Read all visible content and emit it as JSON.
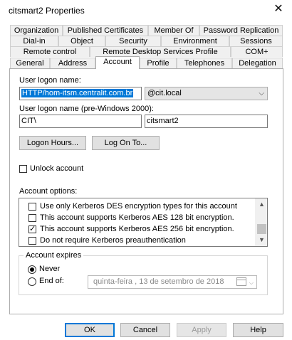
{
  "window": {
    "title": "citsmart2 Properties",
    "close": "✕"
  },
  "tabs": {
    "row1": [
      "Organization",
      "Published Certificates",
      "Member Of",
      "Password Replication"
    ],
    "row2": [
      "Dial-in",
      "Object",
      "Security",
      "Environment",
      "Sessions"
    ],
    "row3": [
      "Remote control",
      "Remote Desktop Services Profile",
      "COM+"
    ],
    "row4": [
      "General",
      "Address",
      "Account",
      "Profile",
      "Telephones",
      "Delegation"
    ],
    "active": "Account"
  },
  "account": {
    "logon_label": "User logon name:",
    "logon_value": "HTTP/hom-itsm.centralit.com.br",
    "domain_value": "@cit.local",
    "pre2000_label": "User logon name (pre-Windows 2000):",
    "pre2000_domain": "CIT\\",
    "pre2000_user": "citsmart2",
    "logon_hours_btn": "Logon Hours...",
    "logon_to_btn": "Log On To...",
    "unlock_label": "Unlock account",
    "options_label": "Account options:",
    "options": [
      {
        "label": "Use only Kerberos DES encryption types for this account",
        "checked": false
      },
      {
        "label": "This account supports Kerberos AES 128 bit encryption.",
        "checked": false
      },
      {
        "label": "This account supports Kerberos AES 256 bit encryption.",
        "checked": true
      },
      {
        "label": "Do not require Kerberos preauthentication",
        "checked": false
      }
    ],
    "expires_label": "Account expires",
    "never_label": "Never",
    "endof_label": "End of:",
    "date_value": "quinta-feira  , 13 de  setembro  de 2018"
  },
  "footer": {
    "ok": "OK",
    "cancel": "Cancel",
    "apply": "Apply",
    "help": "Help"
  },
  "icons": {
    "check": "✓",
    "chevron_down": "⌵",
    "scroll_up": "▲",
    "scroll_down": "▼"
  }
}
